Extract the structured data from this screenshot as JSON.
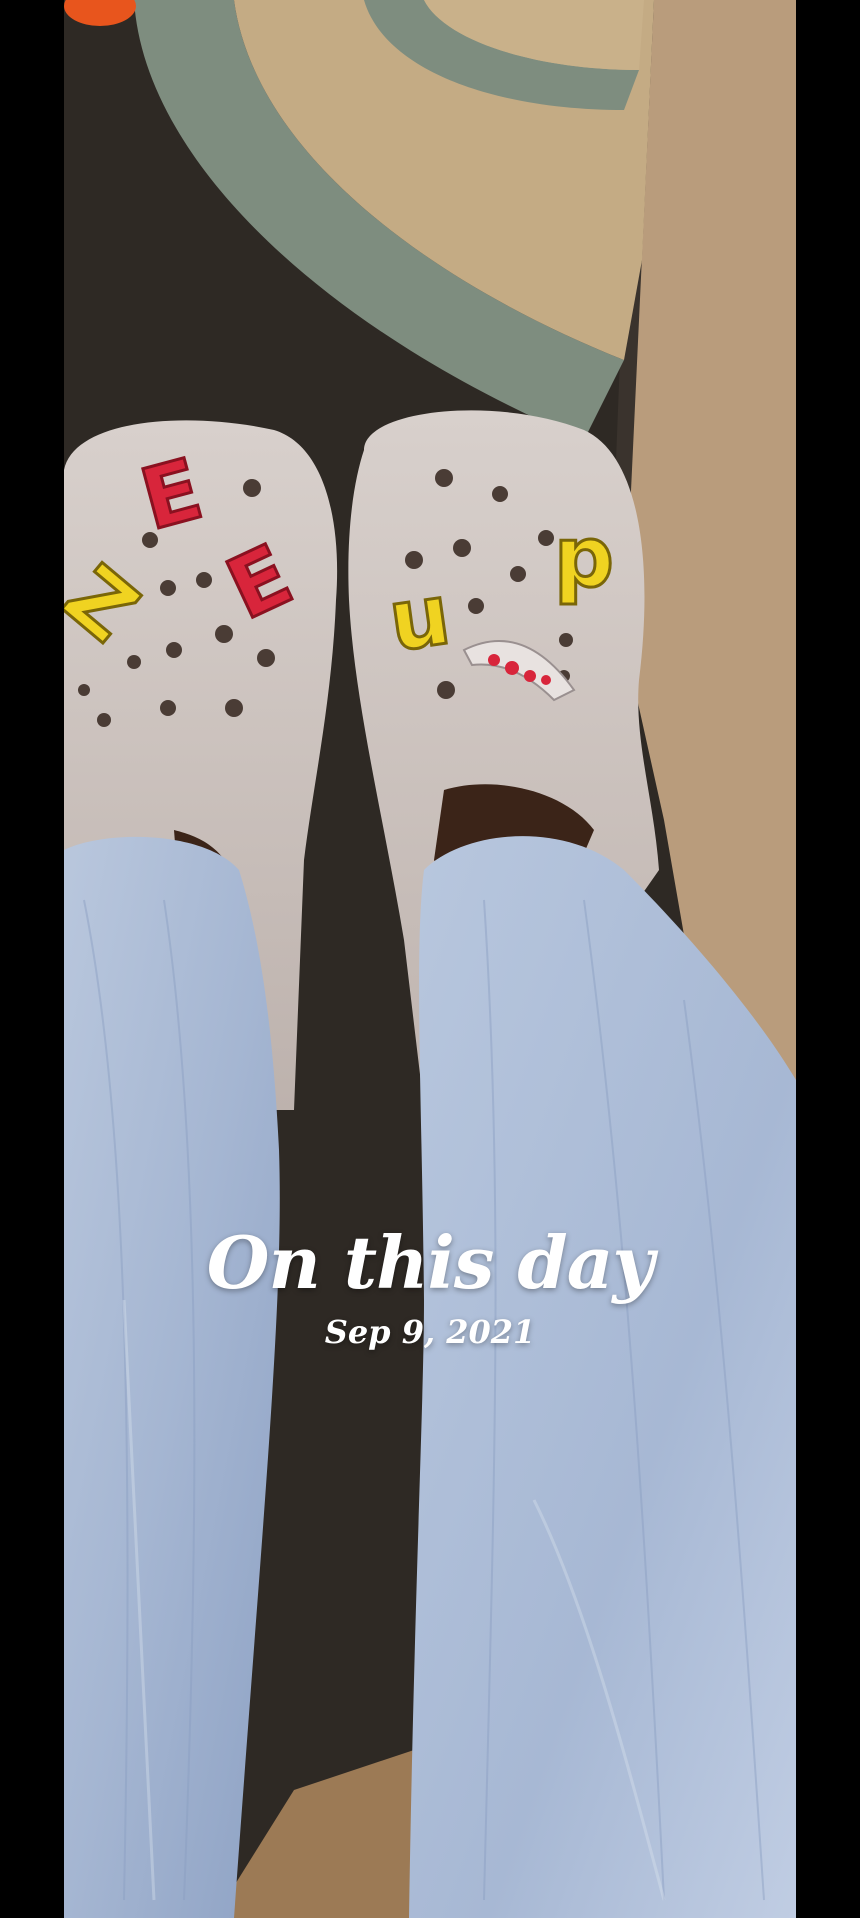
{
  "overlay": {
    "title": "On this day",
    "date": "Sep 9, 2021"
  },
  "photo": {
    "subject": "feet-in-clogs-on-rug",
    "charms_left_shoe": "ZEE",
    "charms_right_shoe": "uP",
    "colors": {
      "rug_dark": "#2e2924",
      "rug_beige": "#c4ab84",
      "rug_teal": "#7e8d7f",
      "carpet": "#b99c7c",
      "clog": "#cfc6c2",
      "denim": "#a9bad6",
      "charm_red": "#d8253b",
      "charm_yellow": "#f0d321"
    }
  }
}
